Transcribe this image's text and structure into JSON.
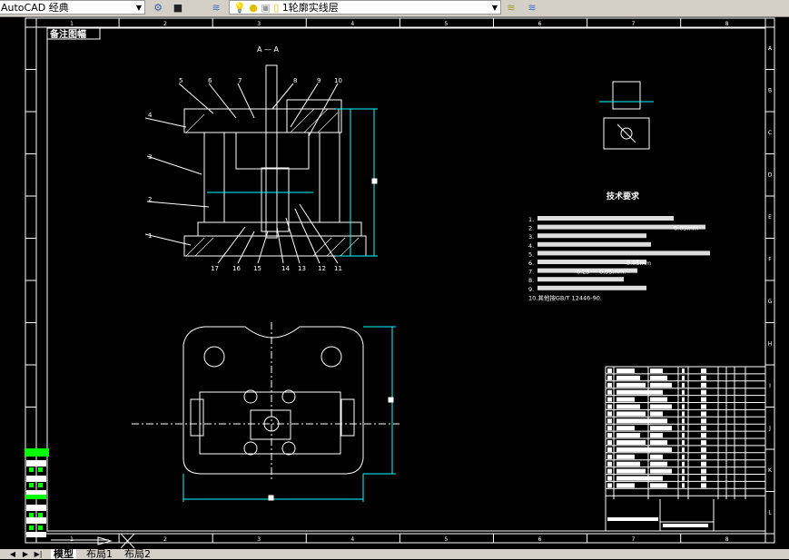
{
  "toolbar": {
    "workspace": "AutoCAD 经典",
    "layer": "1轮廓实线层"
  },
  "tabs": [
    "模型",
    "布局1",
    "布局2"
  ],
  "grid_cols": [
    "1",
    "2",
    "3",
    "4",
    "5",
    "6",
    "7",
    "8"
  ],
  "grid_rows": [
    "A",
    "B",
    "C",
    "D",
    "E",
    "F",
    "G",
    "H",
    "I",
    "J",
    "K",
    "L"
  ],
  "drawing": {
    "corner_label": "备注图幅",
    "section_label": "A — A",
    "part_numbers_top": [
      "5",
      "6",
      "7",
      "8",
      "9",
      "10"
    ],
    "part_numbers_left": [
      "4",
      "3",
      "2",
      "1"
    ],
    "part_numbers_bottom": [
      "17",
      "16",
      "15",
      "14",
      "13",
      "12",
      "11"
    ],
    "tech_title": "技术要求",
    "tech_items": [
      "1.",
      "2.",
      "3.",
      "4.",
      "5.",
      "6.",
      "7.",
      "8.",
      "9.",
      "10.其他按GB/T 12446-90."
    ],
    "tech_fragments": {
      "item2_tail": "0.05mm",
      "item6_tail": "0.05mm",
      "item7_tail": "0.25 — 0.35mm."
    }
  },
  "colors": {
    "background": "#000000",
    "lines": "#ffffff",
    "dimension": "#00ffff",
    "highlight": "#00ff00"
  }
}
